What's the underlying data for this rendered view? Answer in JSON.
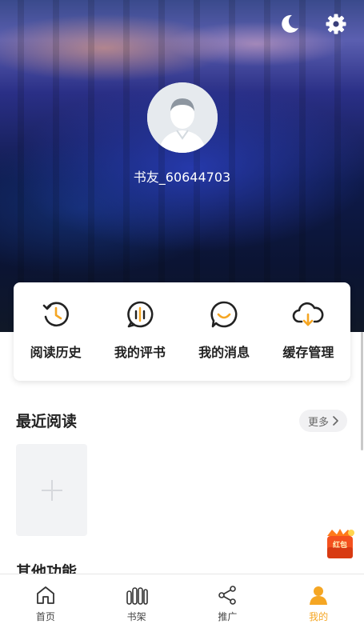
{
  "header": {
    "night_mode_icon": "moon-icon",
    "settings_icon": "gear-icon"
  },
  "profile": {
    "username": "书友_60644703"
  },
  "quick_actions": [
    {
      "label": "阅读历史",
      "icon": "history-icon"
    },
    {
      "label": "我的评书",
      "icon": "comment-icon"
    },
    {
      "label": "我的消息",
      "icon": "message-icon"
    },
    {
      "label": "缓存管理",
      "icon": "cloud-download-icon"
    }
  ],
  "recent": {
    "title": "最近阅读",
    "more_label": "更多"
  },
  "other": {
    "title": "其他功能"
  },
  "float_badge": {
    "text": "红包"
  },
  "tabs": [
    {
      "label": "首页",
      "icon": "home-icon",
      "active": false
    },
    {
      "label": "书架",
      "icon": "bookshelf-icon",
      "active": false
    },
    {
      "label": "推广",
      "icon": "share-icon",
      "active": false
    },
    {
      "label": "我的",
      "icon": "user-icon",
      "active": true
    }
  ],
  "colors": {
    "accent": "#f5a623",
    "icon_dark": "#222222"
  }
}
